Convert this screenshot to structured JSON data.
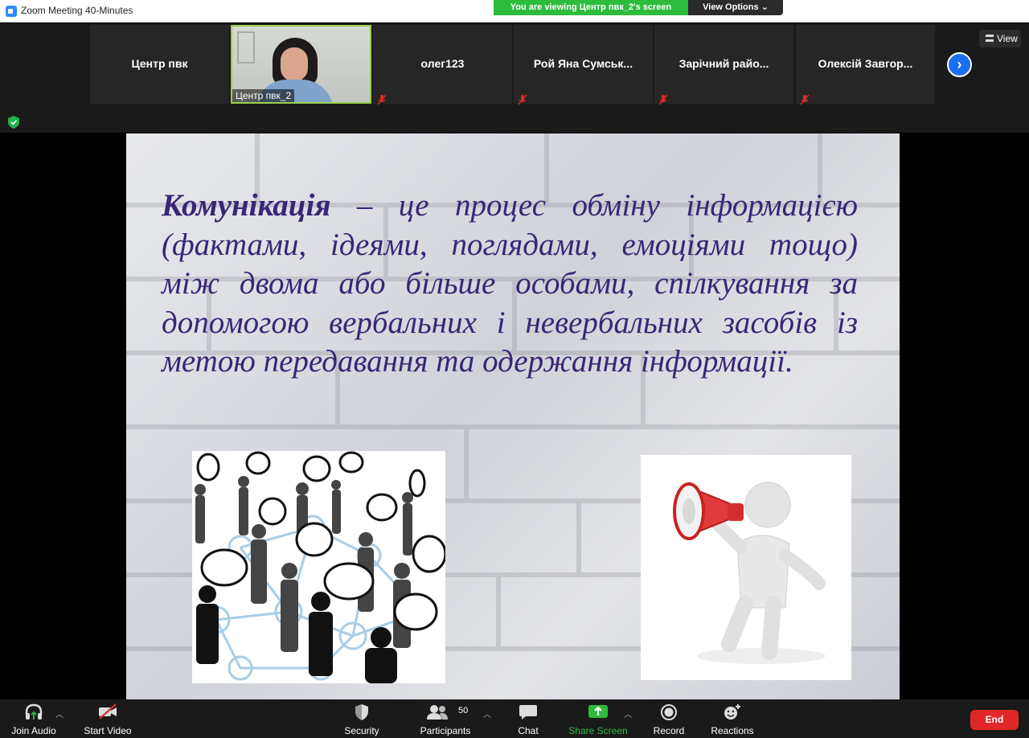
{
  "window": {
    "title": "Zoom Meeting 40-Minutes"
  },
  "banner": {
    "viewing": "You are viewing Центр пвк_2's screen",
    "view_options": "View Options ⌄"
  },
  "gallery": {
    "tiles": [
      {
        "name": "Центр пвк"
      },
      {
        "name": "олег123"
      },
      {
        "name": "Рой Яна Сумськ..."
      },
      {
        "name": "Зарічний райо..."
      },
      {
        "name": "Олексій Завгор..."
      }
    ],
    "video_tile_name": "Центр пвк_2",
    "view_label": "View",
    "next_icon": "chevron-right-icon"
  },
  "slide": {
    "term": "Комунікація",
    "definition": " – це процес обміну інформацією (фактами, ідеями, поглядами, емоціями тощо) між двома або більше особами, спілкування за допомогою вербальних і невербальних засобів із метою передавання та одержання інформації."
  },
  "toolbar": {
    "join_audio": "Join Audio",
    "start_video": "Start Video",
    "security": "Security",
    "participants": "Participants",
    "participants_count": "50",
    "chat": "Chat",
    "share_screen": "Share Screen",
    "record": "Record",
    "reactions": "Reactions",
    "end": "End"
  },
  "colors": {
    "share_green": "#2dbc3c",
    "accent_blue": "#1a6ff0",
    "end_red": "#e02828",
    "slide_text": "#3a2577"
  }
}
